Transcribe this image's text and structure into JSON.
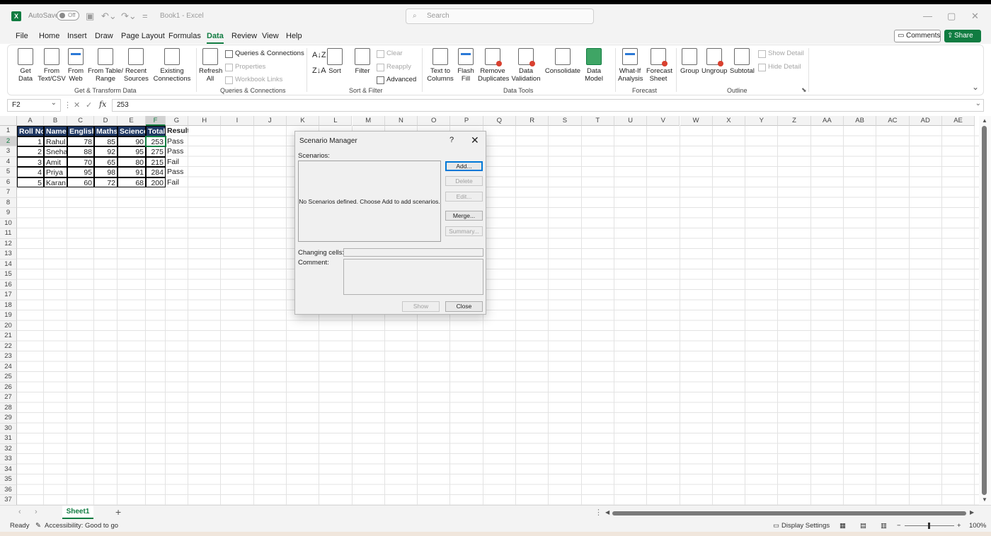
{
  "app": {
    "doc_title": "Book1 - Excel",
    "autosave_label": "AutoSave",
    "autosave_state": "Off",
    "search_placeholder": "Search",
    "brand_color": "#107c41"
  },
  "menu": {
    "tabs": [
      "File",
      "Home",
      "Insert",
      "Draw",
      "Page Layout",
      "Formulas",
      "Data",
      "Review",
      "View",
      "Help"
    ],
    "active": "Data",
    "comments_label": "Comments",
    "share_label": "Share"
  },
  "ribbon": {
    "get_data": "Get Data",
    "from_text_csv": "From Text/CSV",
    "from_web": "From Web",
    "from_table_range": "From Table/ Range",
    "recent_sources": "Recent Sources",
    "existing_connections": "Existing Connections",
    "refresh_all": "Refresh All",
    "queries_connections": "Queries & Connections",
    "properties": "Properties",
    "workbook_links": "Workbook Links",
    "sort": "Sort",
    "filter": "Filter",
    "clear": "Clear",
    "reapply": "Reapply",
    "advanced": "Advanced",
    "text_to_columns": "Text to Columns",
    "flash_fill": "Flash Fill",
    "remove_duplicates": "Remove Duplicates",
    "data_validation": "Data Validation",
    "consolidate": "Consolidate",
    "data_model": "Data Model",
    "what_if": "What-If Analysis",
    "forecast_sheet": "Forecast Sheet",
    "group": "Group",
    "ungroup": "Ungroup",
    "subtotal": "Subtotal",
    "show_detail": "Show Detail",
    "hide_detail": "Hide Detail",
    "groups": {
      "get_transform": "Get & Transform Data",
      "queries": "Queries & Connections",
      "sort_filter": "Sort & Filter",
      "data_tools": "Data Tools",
      "forecast": "Forecast",
      "outline": "Outline"
    }
  },
  "formula_bar": {
    "name_box": "F2",
    "formula": "253"
  },
  "grid": {
    "columns": [
      "A",
      "B",
      "C",
      "D",
      "E",
      "F",
      "G",
      "H",
      "I",
      "J",
      "K",
      "L",
      "M",
      "N",
      "O",
      "P",
      "Q",
      "R",
      "S",
      "T",
      "U",
      "V",
      "W",
      "X",
      "Y",
      "Z",
      "AA",
      "AB",
      "AC",
      "AD",
      "AE"
    ],
    "row_count": 37,
    "headers": [
      "Roll No",
      "Name",
      "English",
      "Maths",
      "Science",
      "Total",
      "Result"
    ],
    "rows": [
      [
        "1",
        "Rahul",
        "78",
        "85",
        "90",
        "253",
        "Pass"
      ],
      [
        "2",
        "Sneha",
        "88",
        "92",
        "95",
        "275",
        "Pass"
      ],
      [
        "3",
        "Amit",
        "70",
        "65",
        "80",
        "215",
        "Fail"
      ],
      [
        "4",
        "Priya",
        "95",
        "98",
        "91",
        "284",
        "Pass"
      ],
      [
        "5",
        "Karan",
        "60",
        "72",
        "68",
        "200",
        "Fail"
      ]
    ]
  },
  "dialog": {
    "title": "Scenario Manager",
    "help": "?",
    "close_x": "✕",
    "scenarios_label": "Scenarios:",
    "empty_message": "No Scenarios defined. Choose Add to add scenarios.",
    "add": "Add...",
    "delete": "Delete",
    "edit": "Edit...",
    "merge": "Merge...",
    "summary": "Summary...",
    "changing_cells_label": "Changing cells:",
    "comment_label": "Comment:",
    "show": "Show",
    "close": "Close"
  },
  "sheets": {
    "tabs": [
      "Sheet1"
    ]
  },
  "status": {
    "ready": "Ready",
    "accessibility": "Accessibility: Good to go",
    "display_settings": "Display Settings",
    "zoom": "100%"
  }
}
